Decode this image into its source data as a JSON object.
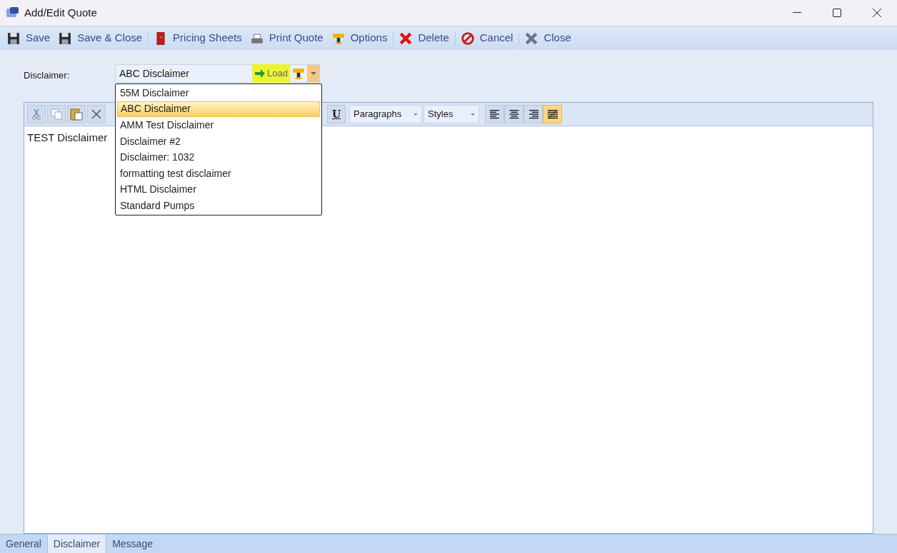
{
  "window": {
    "title": "Add/Edit Quote"
  },
  "toolbar": {
    "groups": [
      [
        "Save",
        "Save & Close"
      ],
      [
        "Pricing Sheets",
        "Print Quote",
        "Options"
      ],
      [
        "Delete"
      ],
      [
        "Cancel"
      ],
      [
        "Close"
      ]
    ]
  },
  "disclaimer": {
    "label": "Disclaimer:",
    "value": "ABC Disclaimer",
    "load_button": "Load",
    "expanded": true,
    "options": [
      {
        "label": "55M Disclaimer",
        "selected": false
      },
      {
        "label": "ABC Disclaimer",
        "selected": true
      },
      {
        "label": "AMM Test Disclaimer",
        "selected": false
      },
      {
        "label": "Disclaimer #2",
        "selected": false
      },
      {
        "label": "Disclaimer: 1032",
        "selected": false
      },
      {
        "label": "formatting test disclaimer",
        "selected": false
      },
      {
        "label": "HTML Disclaimer",
        "selected": false
      },
      {
        "label": "Standard Pumps",
        "selected": false
      }
    ]
  },
  "editor": {
    "underline_button": "U",
    "paragraph_select": "Paragraphs",
    "style_select": "Styles",
    "alignments": [
      {
        "selected": false
      },
      {
        "selected": false
      },
      {
        "selected": false
      },
      {
        "selected": true
      }
    ],
    "content": "TEST Disclaimer"
  },
  "tabs": [
    {
      "label": "General",
      "selected": false
    },
    {
      "label": "Disclaimer",
      "selected": true
    },
    {
      "label": "Message",
      "selected": false
    }
  ]
}
